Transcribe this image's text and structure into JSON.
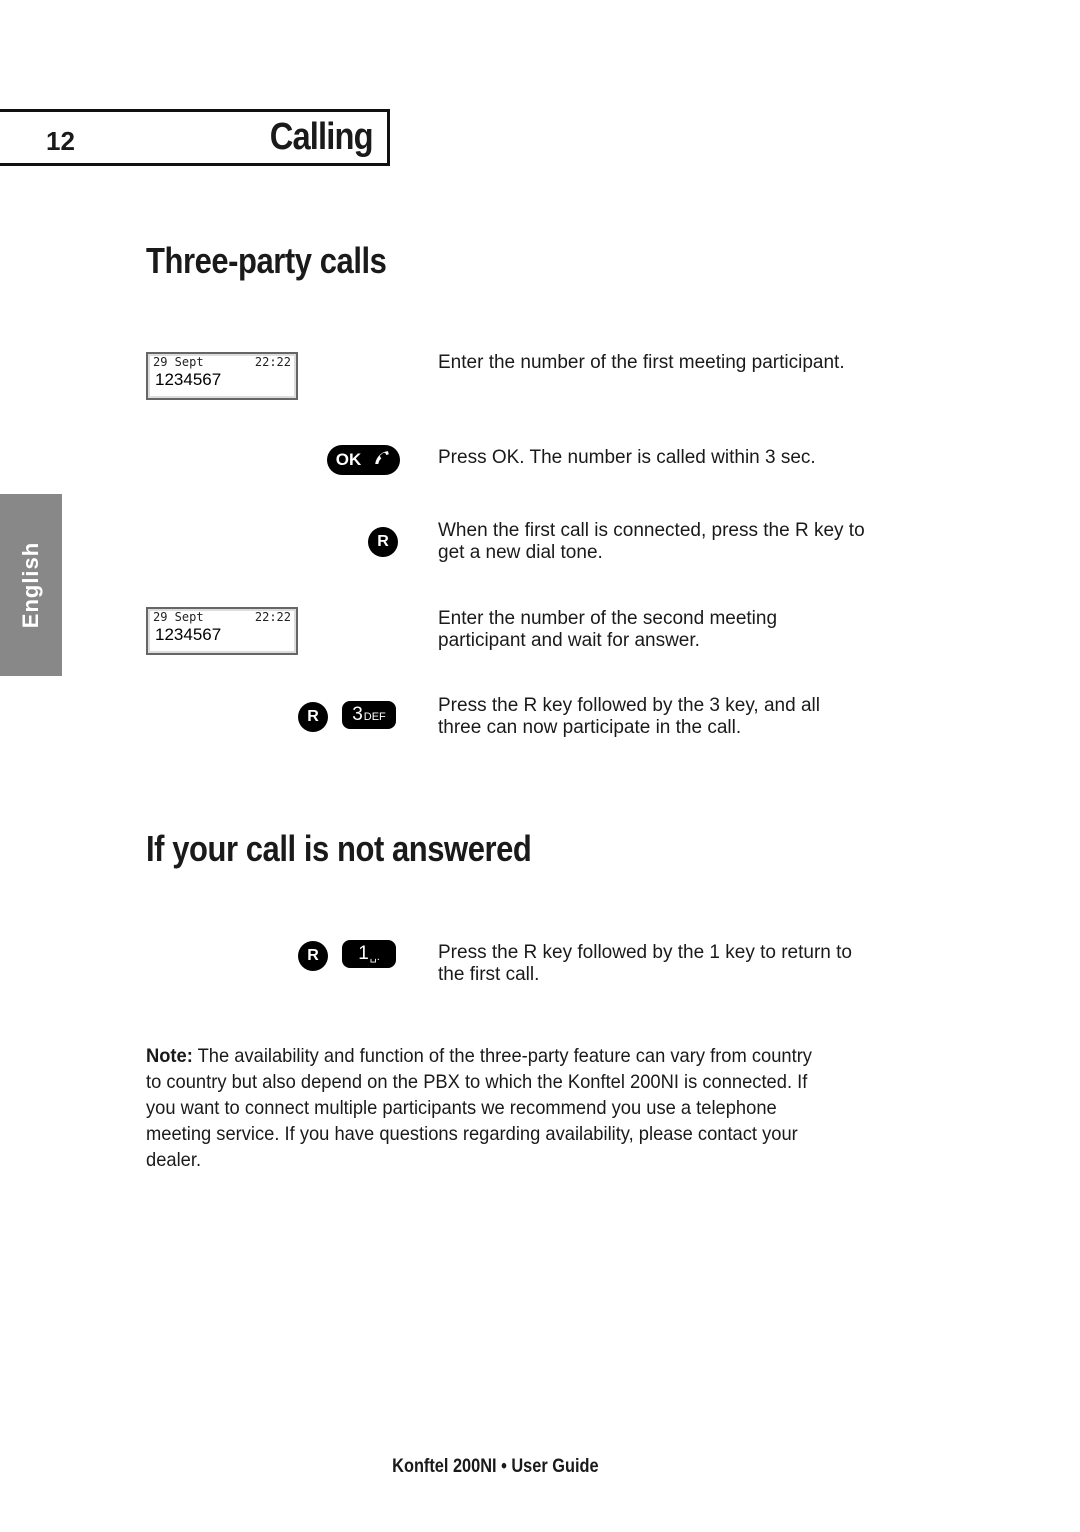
{
  "header": {
    "page_number": "12",
    "chapter_title": "Calling"
  },
  "language_tab": "English",
  "section1": {
    "title": "Three-party calls",
    "steps": [
      {
        "visual": "display",
        "display": {
          "date": "29 Sept",
          "time": "22:22",
          "number": "1234567"
        },
        "text": "Enter the number of the first meeting participant."
      },
      {
        "visual": "keys",
        "keys": [
          {
            "label": "OK",
            "icon": "phone-handset-icon"
          }
        ],
        "text": "Press OK. The number is called within 3 sec."
      },
      {
        "visual": "keys",
        "keys": [
          {
            "label": "R"
          }
        ],
        "text": "When the first call is connected, press the R key to get a new dial tone."
      },
      {
        "visual": "display",
        "display": {
          "date": "29 Sept",
          "time": "22:22",
          "number": "1234567"
        },
        "text": "Enter the number of the second meeting participant and wait for answer."
      },
      {
        "visual": "keys",
        "keys": [
          {
            "label": "R"
          },
          {
            "label": "3",
            "sub": "DEF"
          }
        ],
        "text": "Press the R key followed by the 3 key, and all three can now participate in the call."
      }
    ]
  },
  "section2": {
    "title": "If your call is not answered",
    "steps": [
      {
        "visual": "keys",
        "keys": [
          {
            "label": "R"
          },
          {
            "label": "1",
            "sub": "␣."
          }
        ],
        "text": "Press the R key followed by the 1 key to return to the first call."
      }
    ]
  },
  "note": {
    "label": "Note:",
    "text": " The availability and function of the three-party feature can vary from country to country but also depend on the PBX to which the Konftel 200NI is connected. If you want to connect multiple participants we recommend you use a telephone meeting service. If you have questions regarding availability, please contact your dealer."
  },
  "footer": "Konftel 200NI • User Guide"
}
